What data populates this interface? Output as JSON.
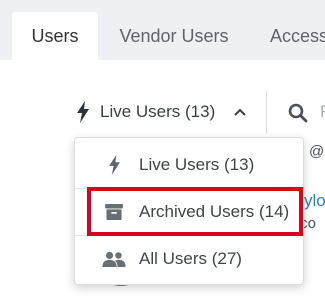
{
  "tabs": [
    {
      "label": "Users",
      "active": true
    },
    {
      "label": "Vendor Users",
      "active": false
    },
    {
      "label": "Access",
      "active": false
    }
  ],
  "filter": {
    "selected_label": "Live Users (13)",
    "icon": "bolt-icon",
    "chevron_icon": "chevron-up-icon",
    "expanded": true
  },
  "search": {
    "icon": "search-icon",
    "placeholder_fragment": "F"
  },
  "menu": {
    "items": [
      {
        "label": "Live Users (13)",
        "icon": "bolt-icon"
      },
      {
        "label": "Archived Users (14)",
        "icon": "archive-box-icon",
        "highlighted": true
      },
      {
        "label": "All Users (27)",
        "icon": "users-icon"
      }
    ]
  },
  "background_rows": {
    "email_fragment": "@m",
    "name_fragment": "ylo",
    "email_fragment_2": ".co"
  },
  "colors": {
    "highlight": "#d9041c",
    "link": "#2d7fc1",
    "background": "#eef0f3"
  }
}
